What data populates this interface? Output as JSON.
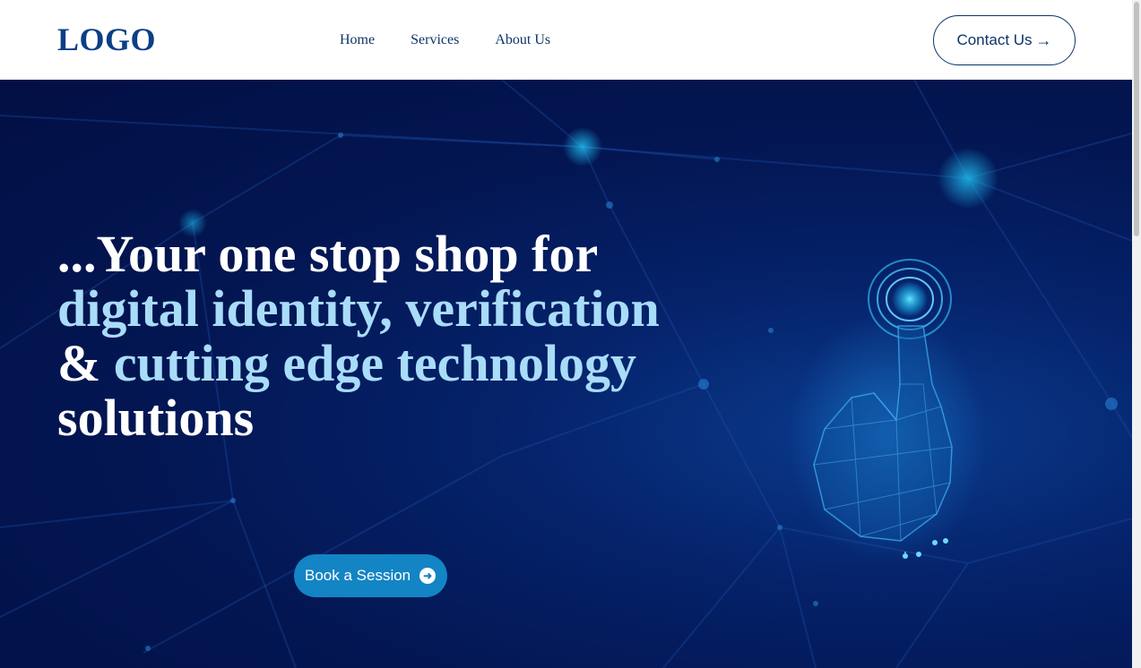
{
  "header": {
    "logo": "LOGO",
    "nav": [
      "Home",
      "Services",
      "About Us"
    ],
    "contact_label": "Contact Us",
    "contact_arrow": "→"
  },
  "hero": {
    "line1": "...Your one stop shop for",
    "line2": "digital identity, verification",
    "line3_amp": "& ",
    "line3_rest": "cutting edge technology",
    "line4": "solutions",
    "cta_label": "Book a Session",
    "cta_icon": "arrow-circle-right-icon"
  },
  "colors": {
    "brand": "#0b3f86",
    "hero_bg": "#031652",
    "highlight": "#a9dcf8",
    "cta": "#1384c4"
  }
}
